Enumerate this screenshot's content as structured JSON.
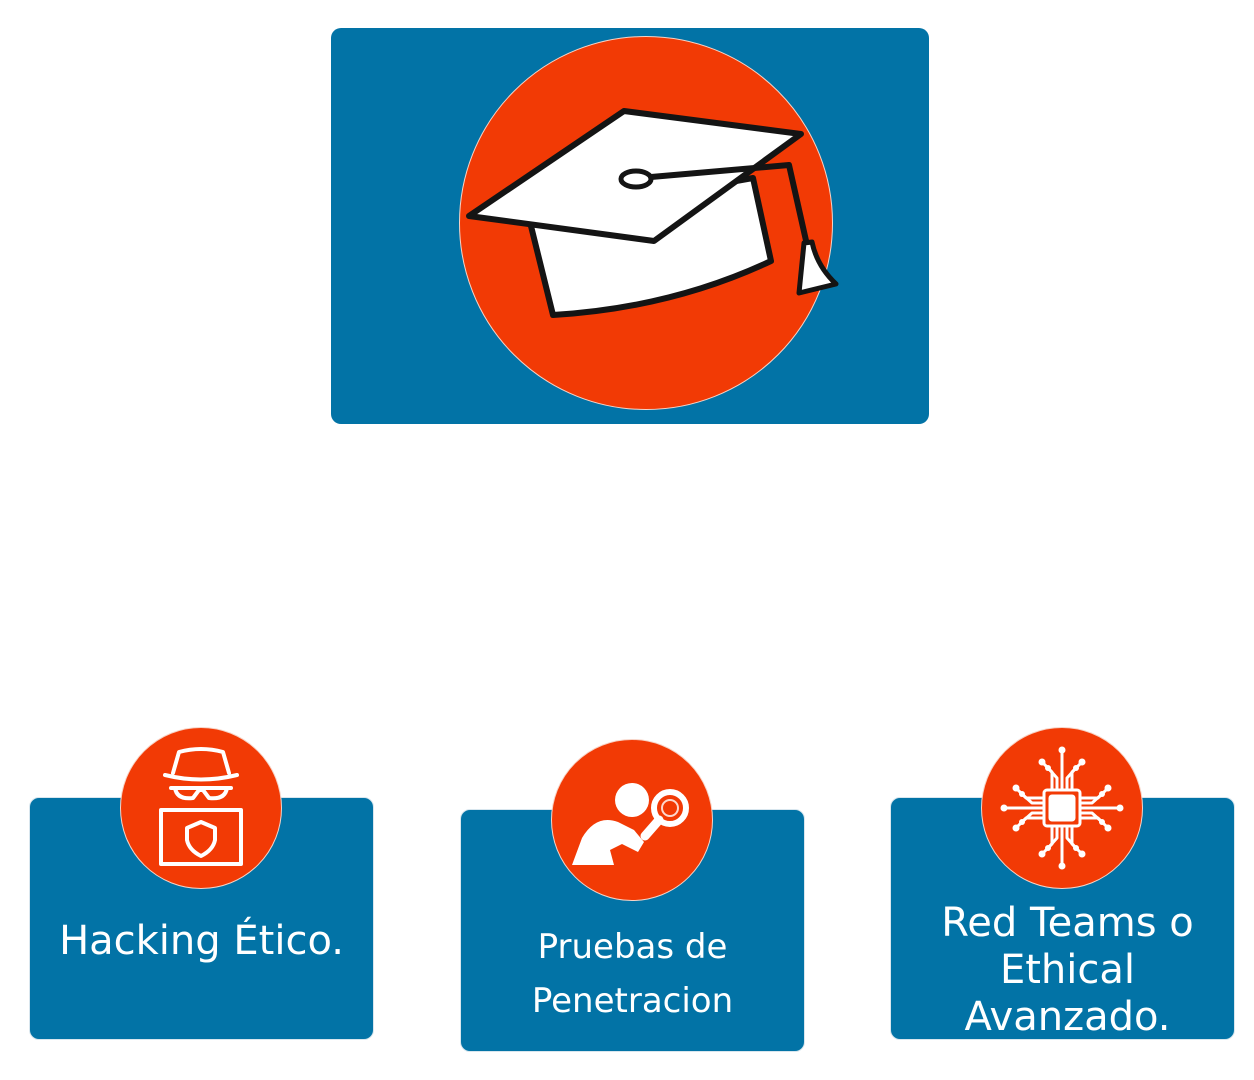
{
  "top_node": {
    "icon": "graduation-cap-icon",
    "colors": {
      "card": "#0273a6",
      "circle": "#f23a05"
    }
  },
  "children": [
    {
      "label": "Hacking Ético.",
      "icon": "hacker-shield-laptop-icon"
    },
    {
      "label": "Pruebas de Penetracion",
      "icon": "magnifier-person-icon"
    },
    {
      "label": "Red Teams o Ethical Avanzado.",
      "icon": "circuit-chip-icon"
    }
  ],
  "colors": {
    "card": "#0273a6",
    "accent": "#f23a05",
    "text": "#ffffff"
  }
}
